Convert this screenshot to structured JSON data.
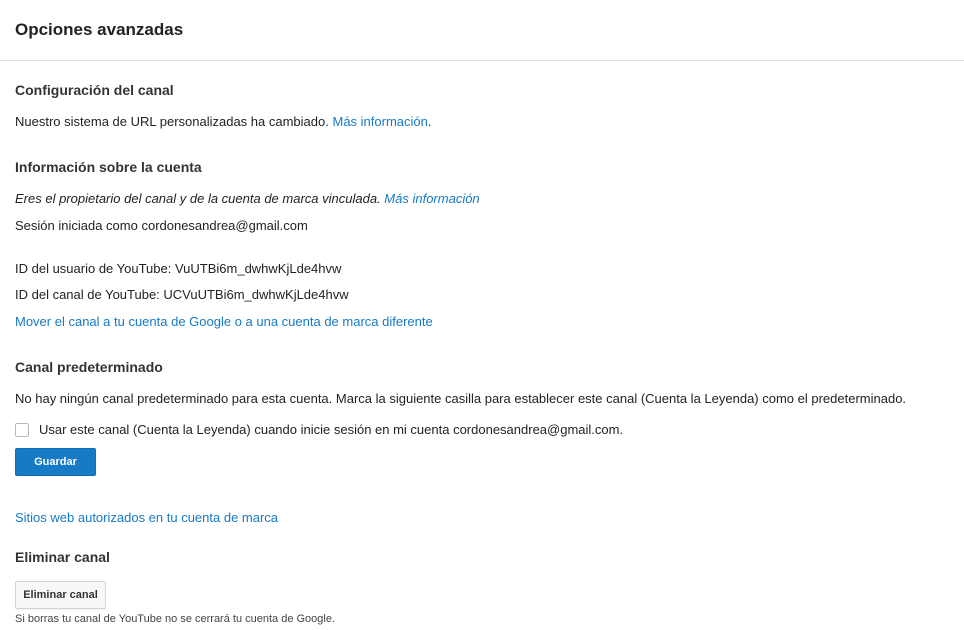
{
  "header": {
    "title": "Opciones avanzadas"
  },
  "channel_settings": {
    "title": "Configuración del canal",
    "text": "Nuestro sistema de URL personalizadas ha cambiado.",
    "link": "Más información",
    "after_link": "."
  },
  "account_info": {
    "title": "Información sobre la cuenta",
    "owner_text": "Eres el propietario del canal y de la cuenta de marca vinculada.",
    "owner_link": "Más información",
    "signed_in": "Sesión iniciada como cordonesandrea@gmail.com",
    "user_id": "ID del usuario de YouTube: VuUTBi6m_dwhwKjLde4hvw",
    "channel_id": "ID del canal de YouTube: UCVuUTBi6m_dwhwKjLde4hvw",
    "move_link": "Mover el canal a tu cuenta de Google o a una cuenta de marca diferente"
  },
  "default_channel": {
    "title": "Canal predeterminado",
    "description": "No hay ningún canal predeterminado para esta cuenta. Marca la siguiente casilla para establecer este canal (Cuenta la Leyenda) como el predeterminado.",
    "checkbox_label": "Usar este canal (Cuenta la Leyenda) cuando inicie sesión en mi cuenta cordonesandrea@gmail.com.",
    "checkbox_checked": false,
    "save_button": "Guardar"
  },
  "authorized_sites": {
    "link": "Sitios web autorizados en tu cuenta de marca"
  },
  "delete_channel": {
    "title": "Eliminar canal",
    "button": "Eliminar canal",
    "note": "Si borras tu canal de YouTube no se cerrará tu cuenta de Google."
  },
  "colors": {
    "link": "#167ac6",
    "primary_button": "#167ac6",
    "text": "#222222"
  }
}
